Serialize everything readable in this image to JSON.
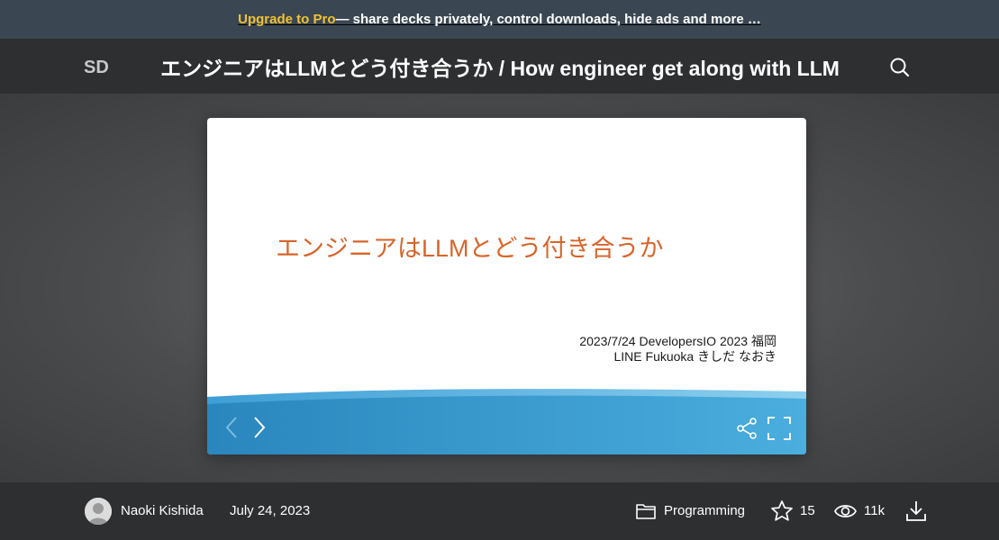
{
  "promo": {
    "link_label": "Upgrade to Pro",
    "text": " — share decks privately, control downloads, hide ads and more …"
  },
  "header": {
    "logo_text": "SD",
    "title": "エンジニアはLLMとどう付き合うか / How engineer get along with LLM",
    "search_icon": "search-icon"
  },
  "slide": {
    "title": "エンジニアはLLMとどう付き合うか",
    "meta_line1": "2023/7/24 DevelopersIO 2023 福岡",
    "meta_line2": "LINE Fukuoka きしだ なおき",
    "controls": [
      "chevron-left-icon",
      "chevron-right-icon",
      "share-icon",
      "fullscreen-icon"
    ]
  },
  "footer": {
    "author": "Naoki Kishida",
    "date": "July 24, 2023",
    "category": "Programming",
    "stars": "15",
    "views": "11k",
    "icons": [
      "folder-icon",
      "star-icon",
      "eye-icon",
      "download-icon"
    ]
  },
  "colors": {
    "promo_bg": "#3a4752",
    "pro_accent": "#f1c232",
    "header_bg": "#2d2f31",
    "slide_title": "#d8642a",
    "slide_bar": "#2b8ec6"
  }
}
